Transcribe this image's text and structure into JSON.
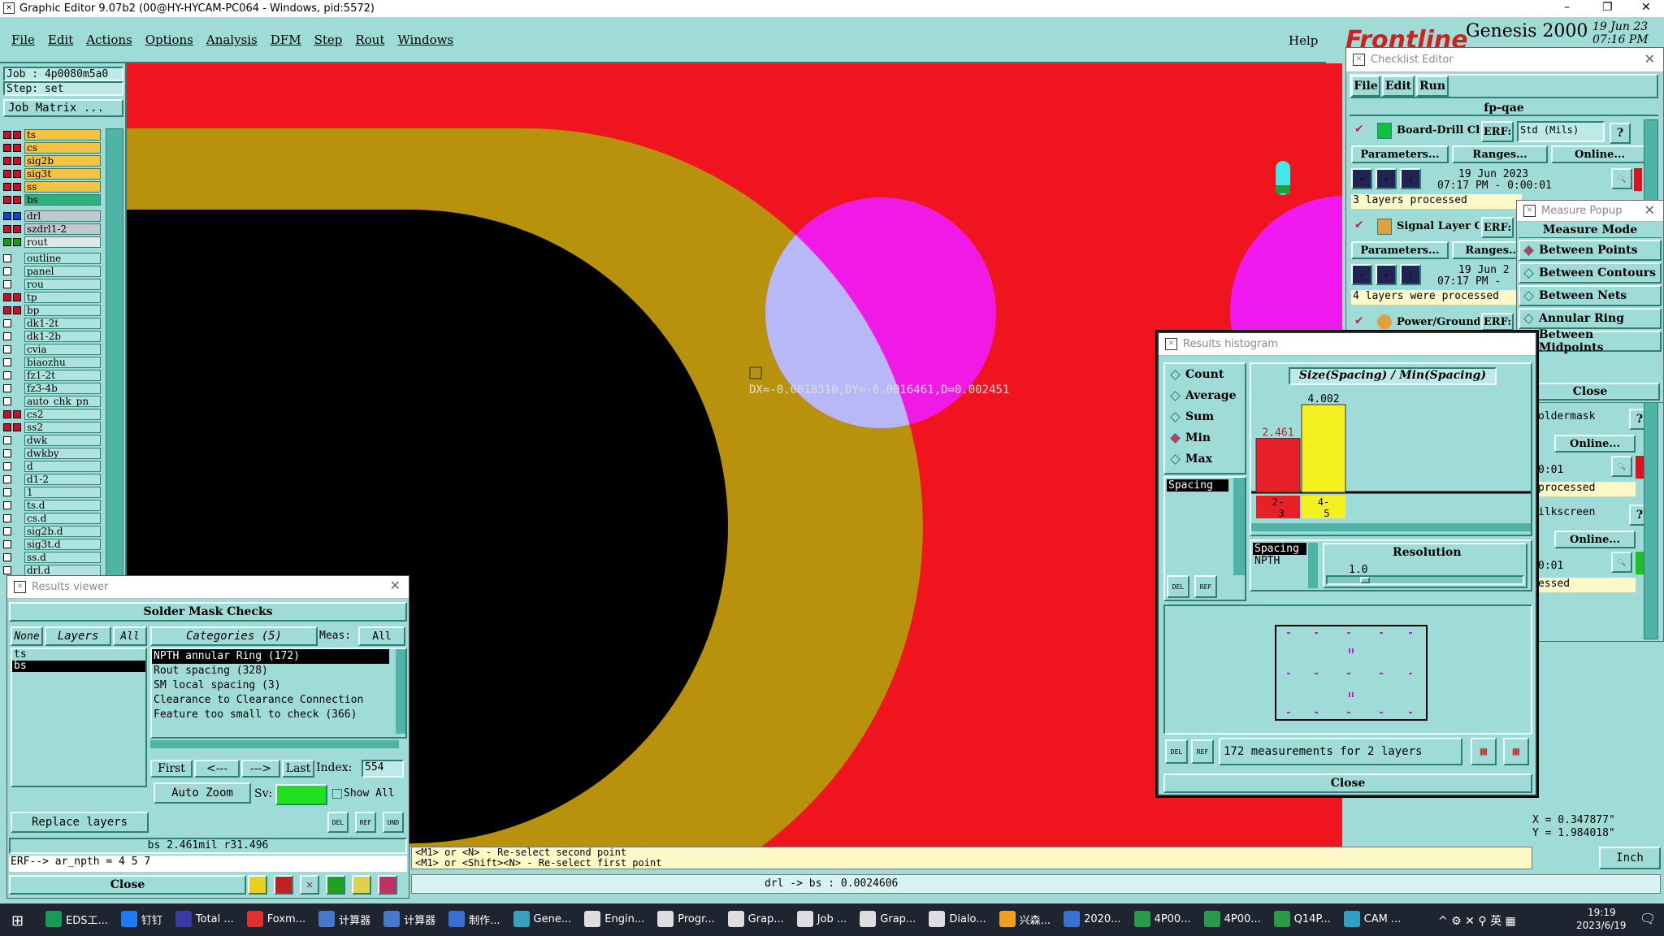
{
  "window": {
    "title": "Graphic Editor 9.07b2 (00@HY-HYCAM-PC064 - Windows, pid:5572)",
    "min": "–",
    "restore": "❐",
    "close": "✕"
  },
  "menu": [
    "File",
    "Edit",
    "Actions",
    "Options",
    "Analysis",
    "DFM",
    "Step",
    "Rout",
    "Windows"
  ],
  "help": "Help",
  "brand": {
    "logo": "Frontline",
    "product": "Genesis 2000",
    "date": "19 Jun 23",
    "time": "07:16 PM"
  },
  "job": {
    "job": "Job : 4p0080m5a0",
    "step": "Step: set",
    "matrix": "Job Matrix ..."
  },
  "layers": [
    {
      "name": "ts",
      "color": "#c8102e",
      "hl": "#f5c242"
    },
    {
      "name": "cs",
      "color": "#c8102e",
      "hl": "#f5c242"
    },
    {
      "name": "sig2b",
      "color": "#c8102e",
      "hl": "#f5c242"
    },
    {
      "name": "sig3t",
      "color": "#c8102e",
      "hl": "#f5c242"
    },
    {
      "name": "ss",
      "color": "#c8102e",
      "hl": "#f5c242"
    },
    {
      "name": "bs",
      "color": "#c8102e",
      "hl": "#30b080"
    },
    {
      "name": "drl",
      "color": "#1040e0",
      "hl": "#c0c8d0",
      "gap": true
    },
    {
      "name": "szdrl1-2",
      "color": "#c8102e",
      "hl": "#c0c8d0"
    },
    {
      "name": "rout",
      "color": "#10a010",
      "hl": "#dde8e8"
    },
    {
      "name": "outline",
      "color": "",
      "hl": "",
      "gap": true
    },
    {
      "name": "panel",
      "color": "",
      "hl": ""
    },
    {
      "name": "rou",
      "color": "",
      "hl": ""
    },
    {
      "name": "tp",
      "color": "#c8102e",
      "hl": ""
    },
    {
      "name": "bp",
      "color": "#c8102e",
      "hl": ""
    },
    {
      "name": "dk1-2t",
      "color": "",
      "hl": ""
    },
    {
      "name": "dk1-2b",
      "color": "",
      "hl": ""
    },
    {
      "name": "cvia",
      "color": "",
      "hl": ""
    },
    {
      "name": "biaozhu",
      "color": "",
      "hl": ""
    },
    {
      "name": "fz1-2t",
      "color": "",
      "hl": ""
    },
    {
      "name": "fz3-4b",
      "color": "",
      "hl": ""
    },
    {
      "name": "auto_chk_pn",
      "color": "",
      "hl": ""
    },
    {
      "name": "cs2",
      "color": "#c8102e",
      "hl": ""
    },
    {
      "name": "ss2",
      "color": "#c8102e",
      "hl": ""
    },
    {
      "name": "dwk",
      "color": "",
      "hl": ""
    },
    {
      "name": "dwkby",
      "color": "",
      "hl": ""
    },
    {
      "name": "d",
      "color": "",
      "hl": ""
    },
    {
      "name": "d1-2",
      "color": "",
      "hl": ""
    },
    {
      "name": "1",
      "color": "",
      "hl": ""
    },
    {
      "name": "ts.d",
      "color": "",
      "hl": ""
    },
    {
      "name": "cs.d",
      "color": "",
      "hl": ""
    },
    {
      "name": "sig2b.d",
      "color": "",
      "hl": ""
    },
    {
      "name": "sig3t.d",
      "color": "",
      "hl": ""
    },
    {
      "name": "ss.d",
      "color": "",
      "hl": ""
    },
    {
      "name": "drl.d",
      "color": "",
      "hl": ""
    }
  ],
  "canvas": {
    "measure_readout": "DX=-0.0018310,DY=-0.0016461,D=0.002451",
    "measure_x": "X = 0.347877\"",
    "measure_y": "Y = 1.984018\"",
    "units": "Inch"
  },
  "checklist": {
    "title": "Checklist Editor",
    "menu": [
      "File",
      "Edit",
      "Run"
    ],
    "name": "fp-qae",
    "items": [
      {
        "name": "Board-Drill Che",
        "erf": "ERF:",
        "erf_val": "Std (Mils)",
        "params": "Parameters...",
        "ranges": "Ranges...",
        "online": "Online...",
        "date": "19 Jun 2023",
        "time": "07:17 PM - 0:00:01",
        "status": "3 layers processed"
      },
      {
        "name": "Signal Layer Ch",
        "erf": "ERF:",
        "params": "Parameters...",
        "ranges": "Ranges...",
        "date": "19 Jun 2",
        "time": "07:17 PM -",
        "status": "4 layers were processed"
      },
      {
        "name": "Power/Ground C",
        "erf": "ERF:"
      }
    ],
    "right_partial": [
      {
        "name": "oldermask",
        "online": "Online...",
        "time": "0:01",
        "status": "processed"
      },
      {
        "name": "ilkscreen",
        "online": "Online...",
        "time": "0:01",
        "status": "essed"
      }
    ]
  },
  "measure": {
    "title": "Measure Popup",
    "header": "Measure Mode",
    "modes": [
      {
        "label": "Between Points",
        "on": true
      },
      {
        "label": "Between Contours",
        "on": false
      },
      {
        "label": "Between Nets",
        "on": false
      },
      {
        "label": "Annular Ring",
        "on": false
      },
      {
        "label": "Between Midpoints",
        "on": false
      }
    ],
    "close": "Close"
  },
  "histogram": {
    "title": "Results histogram",
    "stats": [
      {
        "label": "Count",
        "on": false
      },
      {
        "label": "Average",
        "on": false
      },
      {
        "label": "Sum",
        "on": false
      },
      {
        "label": "Min",
        "on": true
      },
      {
        "label": "Max",
        "on": false
      }
    ],
    "list_sel": "Spacing",
    "chart_title": "Size(Spacing) / Min(Spacing)",
    "list2": [
      "Spacing",
      "NPTH"
    ],
    "resolution_label": "Resolution",
    "resolution": "1.0",
    "summary": "172 measurements for 2 layers",
    "close": "Close",
    "del": "DEL",
    "ref": "REF"
  },
  "chart_data": {
    "type": "bar",
    "categories": [
      "2-3",
      "4-5"
    ],
    "values": [
      2.461,
      4.002
    ],
    "colors": [
      "#e8202a",
      "#f5f020"
    ],
    "title": "Size(Spacing) / Min(Spacing)"
  },
  "results": {
    "title": "Results viewer",
    "header": "Solder Mask Checks",
    "none": "None",
    "layers": "Layers",
    "all": "All",
    "categories": "Categories (5)",
    "meas_label": "Meas:",
    "meas_val": "All",
    "layer_list": [
      "ts",
      "bs"
    ],
    "cat_list": [
      "NPTH annular Ring (172)",
      "Rout spacing (328)",
      "SM local spacing (3)",
      "Clearance to Clearance Connection",
      "Feature too small to check (366)"
    ],
    "first": "First",
    "prev": "<---",
    "next": "--->",
    "last": "Last",
    "index_label": "Index:",
    "index": "554",
    "auto_zoom": "Auto Zoom",
    "sv": "Sv:",
    "show_all": "Show All",
    "replace": "Replace layers",
    "status": "bs 2.461mil  r31.496",
    "erf": "ERF--> ar_npth = 4 5 7",
    "close": "Close"
  },
  "prompts": [
    "<M1> or <N> - Re-select second point",
    "<M1> or <Shift><N> - Re-select first point"
  ],
  "status_bar": "drl -> bs : 0.0024606",
  "taskbar": {
    "items": [
      {
        "label": "EDS工...",
        "color": "#1a9a5a"
      },
      {
        "label": "钉钉",
        "color": "#1e7cf0"
      },
      {
        "label": "Total ...",
        "color": "#3a3aa0"
      },
      {
        "label": "Foxm...",
        "color": "#e03030"
      },
      {
        "label": "计算器",
        "color": "#4a78c8"
      },
      {
        "label": "计算器",
        "color": "#4a78c8"
      },
      {
        "label": "制作...",
        "color": "#3a70d0"
      },
      {
        "label": "Gene...",
        "color": "#3aa0c0"
      },
      {
        "label": "Engin...",
        "color": "#dddddd"
      },
      {
        "label": "Progr...",
        "color": "#dddddd"
      },
      {
        "label": "Grap...",
        "color": "#dddddd"
      },
      {
        "label": "Job ...",
        "color": "#dddddd"
      },
      {
        "label": "Grap...",
        "color": "#dddddd"
      },
      {
        "label": "Dialo...",
        "color": "#dddddd"
      },
      {
        "label": "兴森...",
        "color": "#f0a020"
      },
      {
        "label": "2020...",
        "color": "#3a70d0"
      },
      {
        "label": "4P00...",
        "color": "#2a9a4a"
      },
      {
        "label": "4P00...",
        "color": "#2a9a4a"
      },
      {
        "label": "Q14P...",
        "color": "#2a9a4a"
      },
      {
        "label": "CAM ...",
        "color": "#30a0c0"
      }
    ],
    "tray": "^ ⚙ ✕ ⚲ 英 ▦",
    "time": "19:19",
    "date": "2023/6/19"
  }
}
